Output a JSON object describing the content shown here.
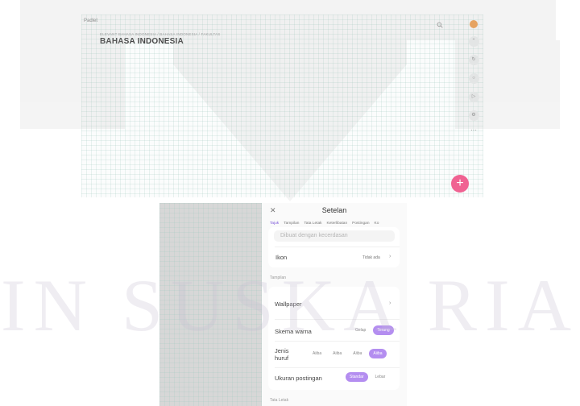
{
  "board": {
    "logo": "Padlet",
    "breadcrumb": "ELEVANT BAHASA INDONESIA / BAHASA INDONESIA / FAKULTAS",
    "title": "BAHASA INDONESIA",
    "search_icon": "search-icon",
    "add_label": "+",
    "more_label": "⋯"
  },
  "settings": {
    "close_label": "✕",
    "header_title": "Setelan",
    "tabs": [
      "Tajuk",
      "Tampilan",
      "Tata Letak",
      "Keterlibatan",
      "Postingan",
      "Ko"
    ],
    "description_placeholder": "Dibuat dengan kecerdasan",
    "icon_row": {
      "label": "Ikon",
      "value": "Tidak ada"
    },
    "section_appearance": "Tampilan",
    "wallpaper_label": "Wallpaper",
    "color_scheme": {
      "label": "Skema warna",
      "options": [
        "Gelap",
        "Terang"
      ],
      "selected": "Terang"
    },
    "font": {
      "label": "Jenis huruf",
      "options": [
        "Aiiba",
        "Aiiba",
        "Aiiba",
        "Aiiba"
      ],
      "selected_index": 3
    },
    "post_size": {
      "label": "Ukuran postingan",
      "options": [
        "Standar",
        "Lebar"
      ],
      "selected": "Standar"
    },
    "section_layout": "Tata Letak",
    "accent": "#b48ef0",
    "tab_accent": "#7a55d9"
  },
  "colors": {
    "fab": "#f06292",
    "avatar": "#f0a050"
  },
  "watermark": "UIN SUSKA RIAU"
}
